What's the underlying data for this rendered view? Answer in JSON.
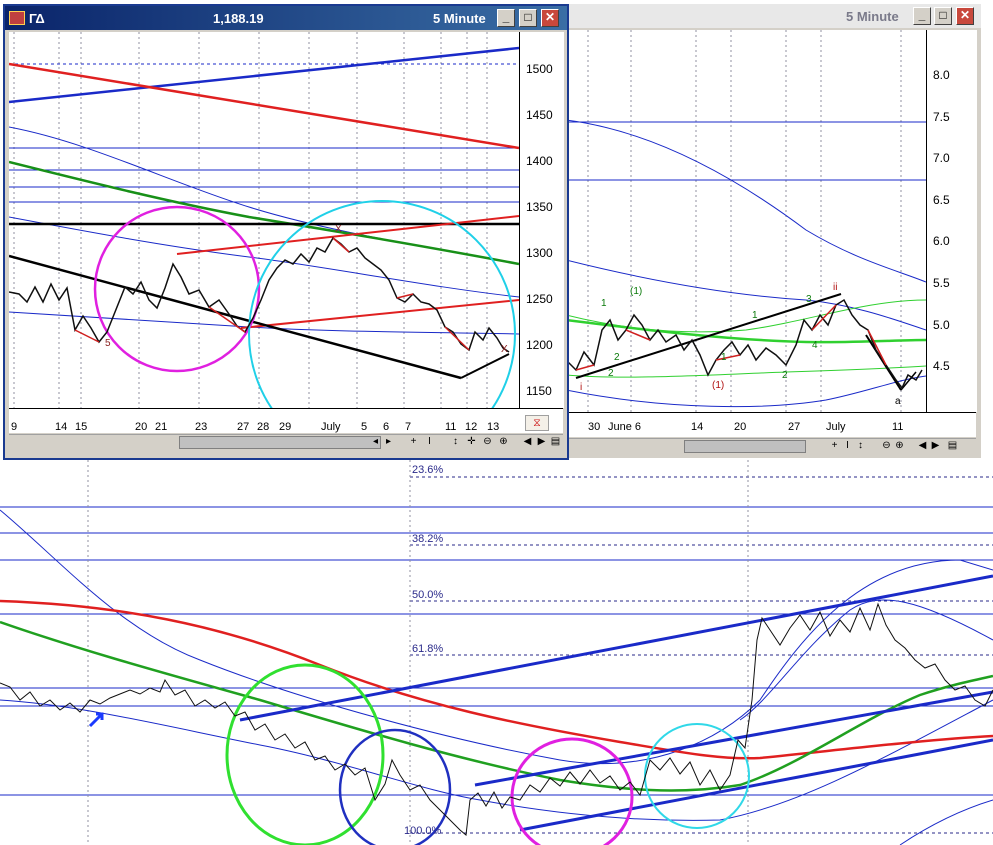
{
  "left_window": {
    "title": "ΓΔ",
    "price": "1,188.19",
    "interval": "5 Minute",
    "y_ticks": [
      "1500",
      "1450",
      "1400",
      "1350",
      "1300",
      "1250",
      "1200",
      "1150"
    ],
    "x_ticks": [
      "9",
      "14",
      "15",
      "20",
      "21",
      "23",
      "27",
      "28",
      "29",
      "July",
      "5",
      "6",
      "7",
      "11",
      "12",
      "13"
    ],
    "wave_labels": [
      "5",
      "X",
      "X"
    ],
    "colors": {
      "magenta_circle": "#e020e0",
      "cyan_circle": "#20d0e8",
      "red_line": "#e02020",
      "green_line": "#189018",
      "blue_line": "#1a2ac8",
      "black_line": "#000000"
    }
  },
  "right_window": {
    "interval": "5 Minute",
    "y_ticks": [
      "8.0",
      "7.5",
      "7.0",
      "6.5",
      "6.0",
      "5.5",
      "5.0",
      "4.5"
    ],
    "x_ticks": [
      "30",
      "June 6",
      "14",
      "20",
      "27",
      "July",
      "11"
    ],
    "wave_labels": [
      "1",
      "2",
      "(1)",
      "1",
      "2",
      "1",
      "3",
      "4",
      "2",
      "(1)",
      "ii",
      "a",
      "i"
    ]
  },
  "main_chart": {
    "fib_levels": [
      "23.6%",
      "38.2%",
      "50.0%",
      "61.8%",
      "100.0%"
    ],
    "colors": {
      "red": "#e02020",
      "green": "#20a020",
      "blue": "#1a2ac8",
      "green_circle": "#30e030",
      "blue_circle": "#2030c0",
      "magenta_circle": "#e020e0",
      "cyan_circle": "#30d8e8"
    }
  },
  "scroll_icons": [
    "scroll-left-icon",
    "scroll-right-icon",
    "cursor-icon",
    "crosshair-icon",
    "move-icon",
    "zoom-out-icon",
    "zoom-in-icon",
    "prev-icon",
    "next-icon",
    "window-icon"
  ],
  "title_buttons": {
    "minimize": "_",
    "maximize": "□",
    "close": "✕"
  }
}
